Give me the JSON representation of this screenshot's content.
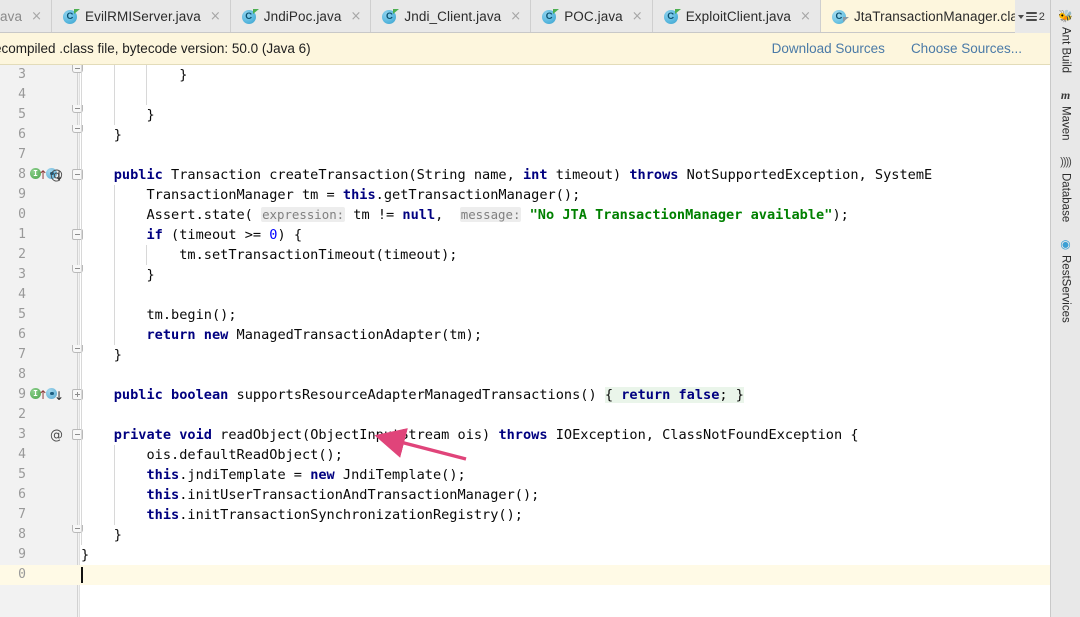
{
  "tabs": [
    {
      "label": "ava",
      "icon": "java-file-icon",
      "truncated": true,
      "active": false
    },
    {
      "label": "EvilRMIServer.java",
      "icon": "java-file-icon",
      "active": false
    },
    {
      "label": "JndiPoc.java",
      "icon": "java-file-icon",
      "active": false
    },
    {
      "label": "Jndi_Client.java",
      "icon": "java-file-icon",
      "active": false
    },
    {
      "label": "POC.java",
      "icon": "java-file-icon",
      "active": false
    },
    {
      "label": "ExploitClient.java",
      "icon": "java-file-icon",
      "active": false
    },
    {
      "label": "JtaTransactionManager.class",
      "icon": "java-class-file-icon",
      "active": true
    }
  ],
  "tab_overflow": {
    "count": "2",
    "icon": "tab-list-dropdown-icon"
  },
  "tab_bug_icon": "ant-bug-icon",
  "close_glyph": "×",
  "notification": {
    "message": "ecompiled .class file, bytecode version: 50.0 (Java 6)",
    "download_sources": "Download Sources",
    "choose_sources": "Choose Sources...",
    "background": "#fdf6dd",
    "link_color": "#4a7aa7"
  },
  "right_toolbar": [
    {
      "label": "Ant Build",
      "icon": "ant-icon",
      "glyph": "⚓"
    },
    {
      "label": "Maven",
      "icon": "maven-icon",
      "glyph": "m"
    },
    {
      "label": "Database",
      "icon": "database-icon",
      "glyph": "))))"
    },
    {
      "label": "RestServices",
      "icon": "rest-services-icon",
      "glyph": "◉"
    }
  ],
  "editor": {
    "caret_line_color": "#fffae6",
    "gutter_color": "#f2f2f2",
    "lines": [
      {
        "ln": "3",
        "fold": "end",
        "indent": 3,
        "segments": [
          {
            "t": "            }",
            "c": "plain"
          }
        ]
      },
      {
        "ln": "4",
        "indent": 3,
        "segments": []
      },
      {
        "ln": "5",
        "fold": "end",
        "indent": 2,
        "segments": [
          {
            "t": "        }",
            "c": "plain"
          }
        ]
      },
      {
        "ln": "6",
        "fold": "end",
        "indent": 1,
        "segments": [
          {
            "t": "    }",
            "c": "plain"
          }
        ]
      },
      {
        "ln": "7",
        "indent": 1,
        "segments": []
      },
      {
        "ln": "8",
        "fold": "open",
        "markers": [
          "override-up",
          "implemented-down",
          "annotation-at"
        ],
        "indent": 1,
        "segments": [
          {
            "t": "    ",
            "c": "plain"
          },
          {
            "t": "public",
            "c": "kw"
          },
          {
            "t": " Transaction createTransaction(String name, ",
            "c": "plain"
          },
          {
            "t": "int",
            "c": "kw"
          },
          {
            "t": " timeout) ",
            "c": "plain"
          },
          {
            "t": "throws",
            "c": "kw"
          },
          {
            "t": " NotSupportedException, SystemE",
            "c": "plain"
          }
        ]
      },
      {
        "ln": "9",
        "indent": 2,
        "segments": [
          {
            "t": "        TransactionManager tm = ",
            "c": "plain"
          },
          {
            "t": "this",
            "c": "kw"
          },
          {
            "t": ".getTransactionManager();",
            "c": "plain"
          }
        ]
      },
      {
        "ln": "0",
        "indent": 2,
        "segments": [
          {
            "t": "        Assert.state( ",
            "c": "plain"
          },
          {
            "t": "expression:",
            "c": "param"
          },
          {
            "t": " tm != ",
            "c": "plain"
          },
          {
            "t": "null",
            "c": "kw"
          },
          {
            "t": ",  ",
            "c": "plain"
          },
          {
            "t": "message:",
            "c": "param"
          },
          {
            "t": " ",
            "c": "plain"
          },
          {
            "t": "\"No JTA TransactionManager available\"",
            "c": "str"
          },
          {
            "t": ");",
            "c": "plain"
          }
        ]
      },
      {
        "ln": "1",
        "fold": "open",
        "indent": 2,
        "segments": [
          {
            "t": "        ",
            "c": "plain"
          },
          {
            "t": "if",
            "c": "kw"
          },
          {
            "t": " (timeout >= ",
            "c": "plain"
          },
          {
            "t": "0",
            "c": "num"
          },
          {
            "t": ") {",
            "c": "plain"
          }
        ]
      },
      {
        "ln": "2",
        "indent": 3,
        "segments": [
          {
            "t": "            tm.setTransactionTimeout(timeout);",
            "c": "plain"
          }
        ]
      },
      {
        "ln": "3",
        "fold": "end",
        "indent": 2,
        "segments": [
          {
            "t": "        }",
            "c": "plain"
          }
        ]
      },
      {
        "ln": "4",
        "indent": 2,
        "segments": []
      },
      {
        "ln": "5",
        "indent": 2,
        "segments": [
          {
            "t": "        tm.begin();",
            "c": "plain"
          }
        ]
      },
      {
        "ln": "6",
        "indent": 2,
        "segments": [
          {
            "t": "        ",
            "c": "plain"
          },
          {
            "t": "return",
            "c": "kw"
          },
          {
            "t": " ",
            "c": "plain"
          },
          {
            "t": "new",
            "c": "kw"
          },
          {
            "t": " ManagedTransactionAdapter(tm);",
            "c": "plain"
          }
        ]
      },
      {
        "ln": "7",
        "fold": "end",
        "indent": 1,
        "segments": [
          {
            "t": "    }",
            "c": "plain"
          }
        ]
      },
      {
        "ln": "8",
        "indent": 1,
        "segments": []
      },
      {
        "ln": "9",
        "fold": "plus",
        "markers": [
          "override-up",
          "implemented-down"
        ],
        "indent": 1,
        "segments": [
          {
            "t": "    ",
            "c": "plain"
          },
          {
            "t": "public",
            "c": "kw"
          },
          {
            "t": " ",
            "c": "plain"
          },
          {
            "t": "boolean",
            "c": "kw"
          },
          {
            "t": " supportsResourceAdapterManagedTransactions() ",
            "c": "plain"
          },
          {
            "t": "{ ",
            "c": "hl"
          },
          {
            "t": "return",
            "c": "kw hl"
          },
          {
            "t": " ",
            "c": "hl"
          },
          {
            "t": "false",
            "c": "kw hl"
          },
          {
            "t": "; }",
            "c": "hl"
          }
        ]
      },
      {
        "ln": "2",
        "indent": 1,
        "segments": []
      },
      {
        "ln": "3",
        "fold": "open",
        "markers": [
          "annotation-at"
        ],
        "indent": 1,
        "segments": [
          {
            "t": "    ",
            "c": "plain"
          },
          {
            "t": "private",
            "c": "kw"
          },
          {
            "t": " ",
            "c": "plain"
          },
          {
            "t": "void",
            "c": "kw"
          },
          {
            "t": " readObject(ObjectInputStream ois) ",
            "c": "plain"
          },
          {
            "t": "throws",
            "c": "kw"
          },
          {
            "t": " IOException, ClassNotFoundException {",
            "c": "plain"
          }
        ]
      },
      {
        "ln": "4",
        "indent": 2,
        "segments": [
          {
            "t": "        ois.defaultReadObject();",
            "c": "plain"
          }
        ]
      },
      {
        "ln": "5",
        "indent": 2,
        "segments": [
          {
            "t": "        ",
            "c": "plain"
          },
          {
            "t": "this",
            "c": "kw"
          },
          {
            "t": ".jndiTemplate = ",
            "c": "plain"
          },
          {
            "t": "new",
            "c": "kw"
          },
          {
            "t": " JndiTemplate();",
            "c": "plain"
          }
        ]
      },
      {
        "ln": "6",
        "indent": 2,
        "segments": [
          {
            "t": "        ",
            "c": "plain"
          },
          {
            "t": "this",
            "c": "kw"
          },
          {
            "t": ".initUserTransactionAndTransactionManager();",
            "c": "plain"
          }
        ]
      },
      {
        "ln": "7",
        "indent": 2,
        "segments": [
          {
            "t": "        ",
            "c": "plain"
          },
          {
            "t": "this",
            "c": "kw"
          },
          {
            "t": ".initTransactionSynchronizationRegistry();",
            "c": "plain"
          }
        ]
      },
      {
        "ln": "8",
        "fold": "end",
        "indent": 1,
        "segments": [
          {
            "t": "    }",
            "c": "plain"
          }
        ]
      },
      {
        "ln": "9",
        "indent": 0,
        "segments": [
          {
            "t": "}",
            "c": "plain"
          }
        ]
      },
      {
        "ln": "0",
        "caret": true,
        "indent": 0,
        "segments": []
      }
    ]
  },
  "annotation_arrow": {
    "color": "#e0447a",
    "description": "pink arrow pointing at readObject ObjectInputStream parameter"
  }
}
